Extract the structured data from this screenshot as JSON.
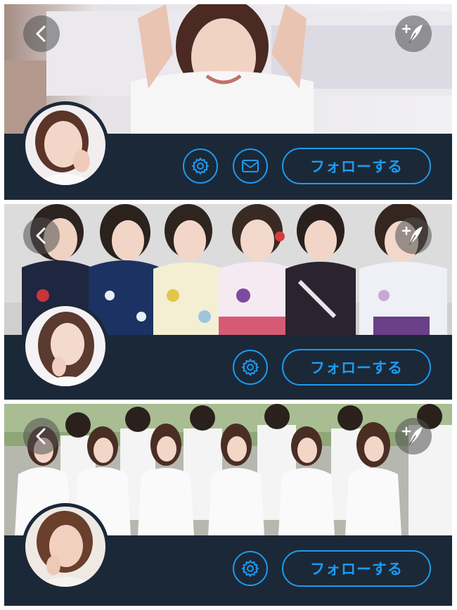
{
  "colors": {
    "bar_background": "#1b2838",
    "accent": "#1d9bf0",
    "page_background": "#ffffff"
  },
  "panels": [
    {
      "name": "profile-header-1",
      "follow_label": "フォローする",
      "has_message_button": true
    },
    {
      "name": "profile-header-2",
      "follow_label": "フォローする",
      "has_message_button": false
    },
    {
      "name": "profile-header-3",
      "follow_label": "フォローする",
      "has_message_button": false
    }
  ],
  "icons": {
    "back": "chevron-left-icon",
    "compose": "compose-feather-icon",
    "settings": "gear-icon",
    "message": "envelope-icon"
  }
}
